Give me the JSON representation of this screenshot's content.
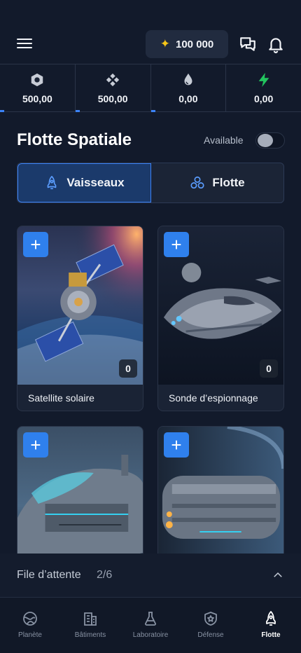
{
  "header": {
    "credits": "100 000"
  },
  "resources": [
    {
      "icon": "hexagon-metal-icon",
      "value": "500,00"
    },
    {
      "icon": "crystal-diamond-icon",
      "value": "500,00"
    },
    {
      "icon": "water-drop-icon",
      "value": "0,00"
    },
    {
      "icon": "energy-bolt-icon",
      "value": "0,00"
    }
  ],
  "page": {
    "title": "Flotte Spatiale",
    "available_label": "Available"
  },
  "tabs": [
    {
      "label": "Vaisseaux",
      "icon": "rocket-icon",
      "active": true
    },
    {
      "label": "Flotte",
      "icon": "fleet-icon",
      "active": false
    }
  ],
  "cards": [
    {
      "name": "Satellite solaire",
      "count": "0",
      "add": "+"
    },
    {
      "name": "Sonde d’espionnage",
      "count": "0",
      "add": "+"
    },
    {
      "name": "",
      "count": "",
      "add": "+"
    },
    {
      "name": "",
      "count": "",
      "add": "+"
    }
  ],
  "queue": {
    "label": "File d’attente",
    "count": "2/6"
  },
  "nav": [
    {
      "label": "Planète",
      "icon": "planet-icon"
    },
    {
      "label": "Bâtiments",
      "icon": "buildings-icon"
    },
    {
      "label": "Laboratoire",
      "icon": "flask-icon"
    },
    {
      "label": "Défense",
      "icon": "shield-star-icon"
    },
    {
      "label": "Flotte",
      "icon": "rocket-icon",
      "active": true
    }
  ],
  "colors": {
    "background": "#121a2b",
    "accent": "#2f80ed",
    "star": "#f5c518",
    "energy": "#22c55e"
  }
}
